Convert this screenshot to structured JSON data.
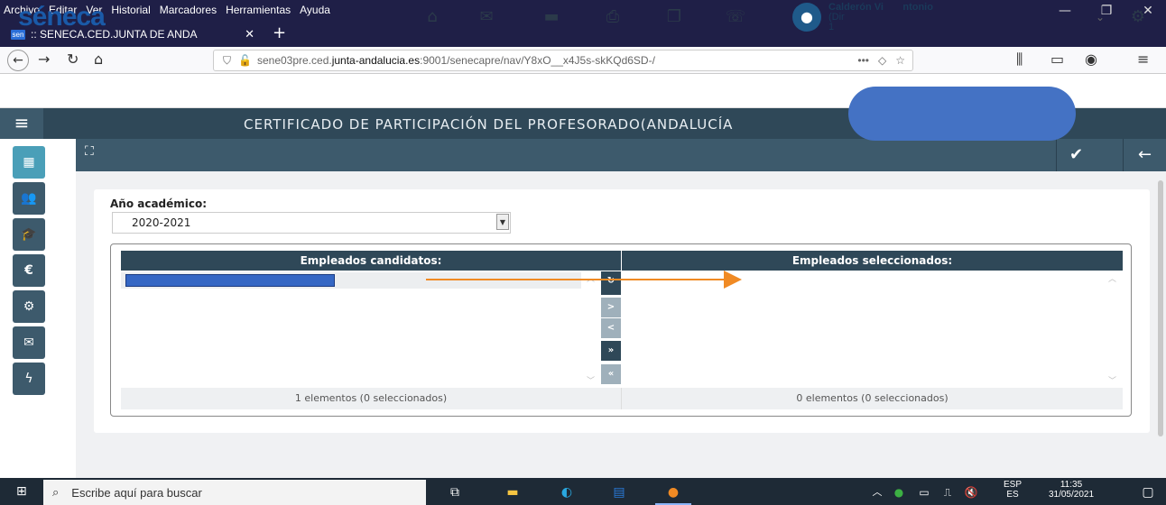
{
  "browser": {
    "menu": [
      "Archivo",
      "Editar",
      "Ver",
      "Historial",
      "Marcadores",
      "Herramientas",
      "Ayuda"
    ],
    "tab_title": ":: SENECA.CED.JUNTA DE ANDA",
    "tab_favicon": "sen",
    "url_prefix": "sene03pre.ced.",
    "url_domain": "junta-andalucia.es",
    "url_rest": ":9001/senecapre/nav/Y8xO__x4J5s-skKQd6SD-/",
    "url_more": "•••"
  },
  "app": {
    "logo": "séneca",
    "user_name": "Calderón Vi",
    "user_name_tail": "ntonio",
    "user_role": "(Dir",
    "user_extra": "1",
    "page_title": "CERTIFICADO DE PARTICIPACIÓN DEL PROFESORADO(ANDALUCÍA",
    "colors": {
      "accent": "#2f4858",
      "brand": "#1a5aa8",
      "active": "#4a9fb8"
    }
  },
  "form": {
    "ano_label": "Año académico:",
    "ano_value": "2020-2021",
    "candidates_header": "Empleados candidatos:",
    "selected_header": "Empleados seleccionados:",
    "candidates_footer": "1 elementos (0 seleccionados)",
    "selected_footer": "0 elementos (0 seleccionados)",
    "btn_add": ">",
    "btn_remove": "<",
    "btn_add_all": "»",
    "btn_remove_all": "«"
  },
  "taskbar": {
    "search_placeholder": "Escribe aquí para buscar",
    "lang": "ESP",
    "lang_sub": "ES",
    "time": "11:35",
    "date": "31/05/2021"
  }
}
